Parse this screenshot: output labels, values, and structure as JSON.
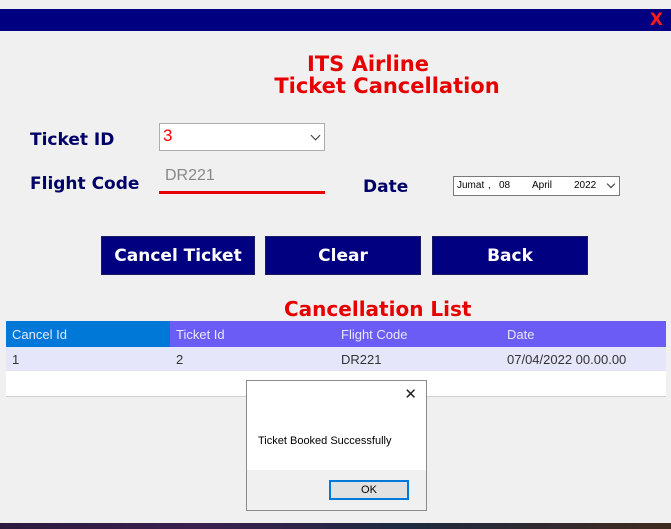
{
  "window": {
    "close_label": "X"
  },
  "header": {
    "title_line1": "ITS Airline",
    "title_line2": "Ticket Cancellation"
  },
  "form": {
    "ticket_id_label": "Ticket ID",
    "ticket_id_value": "3",
    "flight_code_label": "Flight Code",
    "flight_code_value": "DR221",
    "date_label": "Date",
    "date_parts": {
      "weekday": "Jumat",
      "sep": ",",
      "day": "08",
      "month": "April",
      "year": "2022"
    }
  },
  "buttons": {
    "cancel": "Cancel Ticket",
    "clear": "Clear",
    "back": "Back"
  },
  "list": {
    "title": "Cancellation List",
    "columns": [
      "Cancel Id",
      "Ticket Id",
      "Flight Code",
      "Date"
    ],
    "rows": [
      [
        "1",
        "2",
        "DR221",
        "07/04/2022 00.00.00"
      ]
    ]
  },
  "dialog": {
    "message": "Ticket Booked Successfully",
    "ok_label": "OK",
    "close_label": "✕"
  },
  "colors": {
    "titlebar": "#000080",
    "accent_red": "#e60000",
    "button": "#000080",
    "grid_header": "#6a5cf5",
    "grid_header_first": "#0078d7"
  }
}
